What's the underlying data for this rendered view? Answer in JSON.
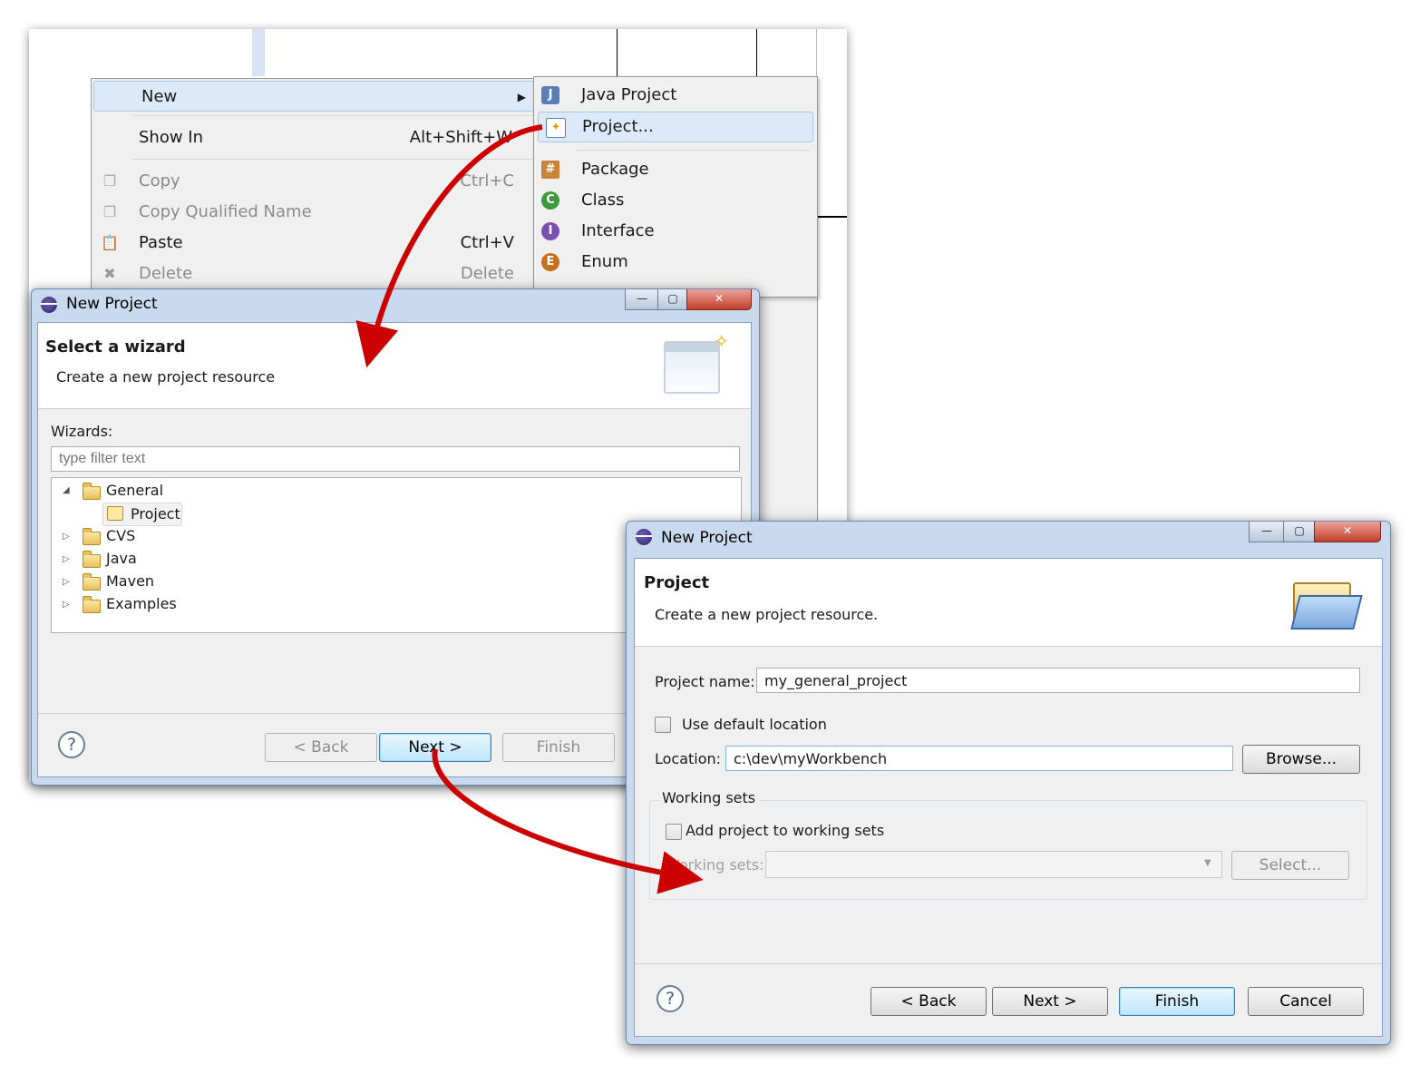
{
  "context_menu": {
    "items": [
      {
        "label": "New",
        "shortcut": "",
        "has_submenu": true,
        "enabled": true,
        "icon": ""
      },
      {
        "label": "Show In",
        "shortcut": "Alt+Shift+W",
        "has_submenu": true,
        "enabled": true,
        "icon": ""
      },
      {
        "label": "Copy",
        "shortcut": "Ctrl+C",
        "enabled": false,
        "icon": "copy-icon"
      },
      {
        "label": "Copy Qualified Name",
        "shortcut": "",
        "enabled": false,
        "icon": "copy-qualified-icon"
      },
      {
        "label": "Paste",
        "shortcut": "Ctrl+V",
        "enabled": true,
        "icon": "paste-icon"
      },
      {
        "label": "Delete",
        "shortcut": "Delete",
        "enabled": false,
        "icon": "delete-icon"
      }
    ]
  },
  "submenu": {
    "items": [
      {
        "label": "Java Project",
        "icon": "java-project-icon"
      },
      {
        "label": "Project...",
        "icon": "project-icon",
        "highlighted": true
      },
      {
        "label": "Package",
        "icon": "package-icon"
      },
      {
        "label": "Class",
        "icon": "class-icon"
      },
      {
        "label": "Interface",
        "icon": "interface-icon"
      },
      {
        "label": "Enum",
        "icon": "enum-icon"
      }
    ]
  },
  "wizard1": {
    "title": "New Project",
    "banner_title": "Select a wizard",
    "banner_desc": "Create a new project resource",
    "wizards_label": "Wizards:",
    "filter_placeholder": "type filter text",
    "tree": [
      {
        "label": "General",
        "expanded": true,
        "level": 0
      },
      {
        "label": "Project",
        "level": 1,
        "selected": true
      },
      {
        "label": "CVS",
        "expanded": false,
        "level": 0
      },
      {
        "label": "Java",
        "expanded": false,
        "level": 0
      },
      {
        "label": "Maven",
        "expanded": false,
        "level": 0
      },
      {
        "label": "Examples",
        "expanded": false,
        "level": 0
      }
    ],
    "buttons": {
      "back": "< Back",
      "next": "Next >",
      "finish": "Finish"
    },
    "help": "?"
  },
  "wizard2": {
    "title": "New Project",
    "banner_title": "Project",
    "banner_desc": "Create a new project resource.",
    "project_name_label": "Project name:",
    "project_name_value": "my_general_project",
    "use_default_label": "Use default location",
    "use_default_checked": false,
    "location_label": "Location:",
    "location_value": "c:\\dev\\myWorkbench",
    "browse_label": "Browse...",
    "working_sets_group": "Working sets",
    "add_to_ws_label": "Add project to working sets",
    "add_to_ws_checked": false,
    "ws_label": "Working sets:",
    "ws_value": "",
    "select_label": "Select...",
    "buttons": {
      "back": "< Back",
      "next": "Next >",
      "finish": "Finish",
      "cancel": "Cancel"
    },
    "help": "?"
  },
  "window_controls": {
    "minimize": "—",
    "maximize": "▢",
    "close": "✕"
  },
  "colors": {
    "arrow": "#cc0000",
    "highlight": "#dce9f8",
    "title_bar": "#c9daef"
  }
}
